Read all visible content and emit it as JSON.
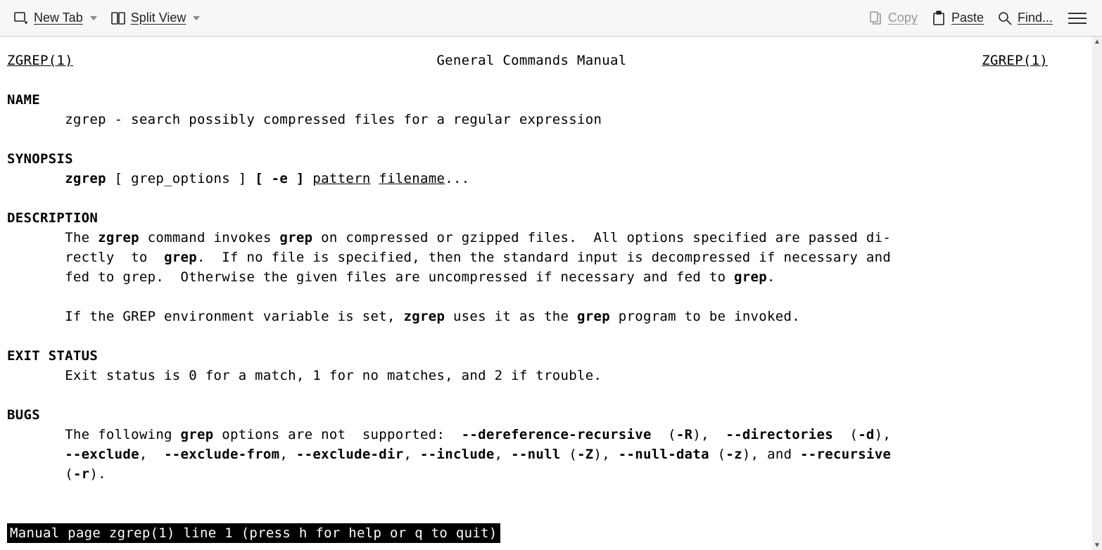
{
  "toolbar": {
    "new_tab": "New Tab",
    "split_view": "Split View",
    "copy": "Copy",
    "paste": "Paste",
    "find": "Find..."
  },
  "man": {
    "header_left": "ZGREP(1)",
    "header_center": "General Commands Manual",
    "header_right": "ZGREP(1)",
    "name_heading": "NAME",
    "name_text": "zgrep - search possibly compressed files for a regular expression",
    "synopsis_heading": "SYNOPSIS",
    "synopsis_cmd": "zgrep",
    "synopsis_mid": " [ grep_options ] ",
    "synopsis_bold1": "[ -e ]",
    "synopsis_pat": "pattern",
    "synopsis_file": "filename",
    "synopsis_tail": "...",
    "description_heading": "DESCRIPTION",
    "desc_l1a": "The ",
    "desc_l1b": "zgrep",
    "desc_l1c": " command invokes ",
    "desc_l1d": "grep",
    "desc_l1e": " on compressed or gzipped files.  All options specified are passed di‐",
    "desc_l2a": "rectly  to  ",
    "desc_l2b": "grep",
    "desc_l2c": ".  If no file is specified, then the standard input is decompressed if necessary and",
    "desc_l3a": "fed to grep.  Otherwise the given files are uncompressed if necessary and fed to ",
    "desc_l3b": "grep",
    "desc_l3c": ".",
    "desc_l4a": "If the GREP environment variable is set, ",
    "desc_l4b": "zgrep",
    "desc_l4c": " uses it as the ",
    "desc_l4d": "grep",
    "desc_l4e": " program to be invoked.",
    "exit_heading": "EXIT STATUS",
    "exit_text": "Exit status is 0 for a match, 1 for no matches, and 2 if trouble.",
    "bugs_heading": "BUGS",
    "bugs_l1a": "The following ",
    "bugs_l1b": "grep",
    "bugs_l1c": " options are not  supported:  ",
    "bugs_l1d": "--dereference-recursive",
    "bugs_l1e": "  (",
    "bugs_l1f": "-R",
    "bugs_l1g": "),  ",
    "bugs_l1h": "--directories",
    "bugs_l1i": "  (",
    "bugs_l1j": "-d",
    "bugs_l1k": "),",
    "bugs_l2a": "--exclude",
    "bugs_l2b": ",  ",
    "bugs_l2c": "--exclude-from",
    "bugs_l2d": ", ",
    "bugs_l2e": "--exclude-dir",
    "bugs_l2f": ", ",
    "bugs_l2g": "--include",
    "bugs_l2h": ", ",
    "bugs_l2i": "--null",
    "bugs_l2j": " (",
    "bugs_l2k": "-Z",
    "bugs_l2l": "), ",
    "bugs_l2m": "--null-data",
    "bugs_l2n": " (",
    "bugs_l2o": "-z",
    "bugs_l2p": "), and ",
    "bugs_l2q": "--recursive",
    "bugs_l3a": "(",
    "bugs_l3b": "-r",
    "bugs_l3c": ")."
  },
  "status": " Manual page zgrep(1) line 1 (press h for help or q to quit)"
}
